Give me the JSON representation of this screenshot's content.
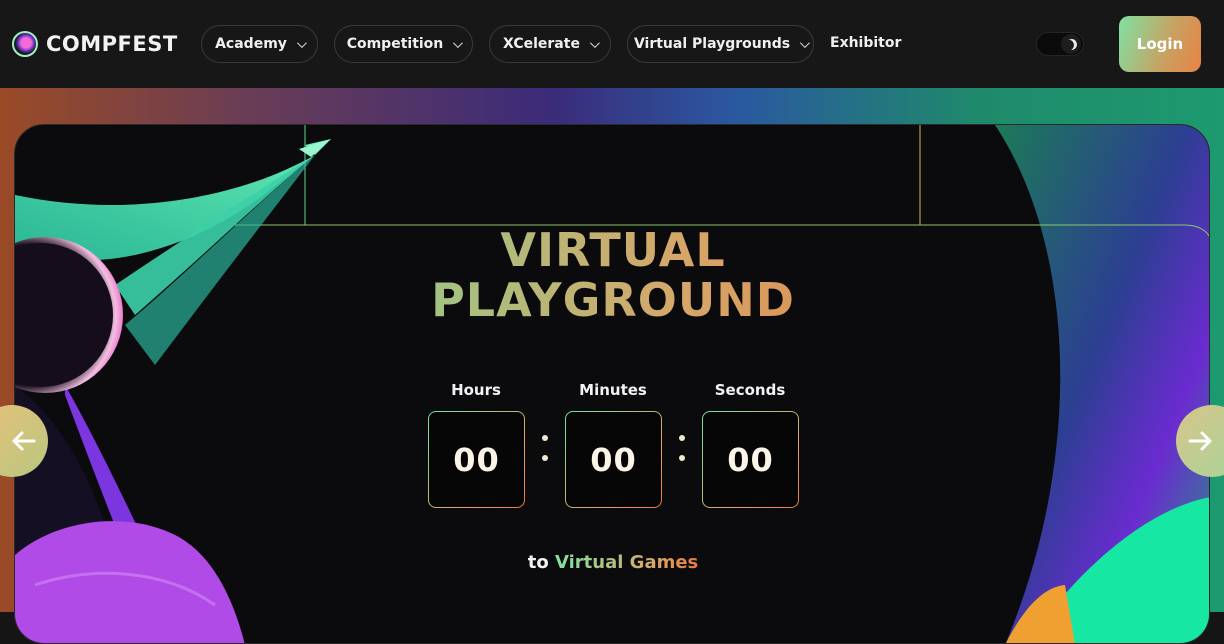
{
  "brand": {
    "name": "COMPFEST"
  },
  "nav": {
    "items": [
      {
        "label": "Academy"
      },
      {
        "label": "Competition"
      },
      {
        "label": "XCelerate"
      },
      {
        "label": "Virtual Playgrounds"
      }
    ],
    "link": "Exhibitor",
    "login_label": "Login",
    "theme_icon": "moon-icon"
  },
  "hero": {
    "title_line1": "VIRTUAL",
    "title_line2": "PLAYGROUND",
    "timer": {
      "hours_label": "Hours",
      "minutes_label": "Minutes",
      "seconds_label": "Seconds",
      "hours": "00",
      "minutes": "00",
      "seconds": "00"
    },
    "subtitle_prefix": "to",
    "subtitle_highlight": "Virtual Games",
    "prev_icon": "arrow-left-icon",
    "next_icon": "arrow-right-icon"
  },
  "colors": {
    "accent_green": "#66e3a1",
    "accent_orange": "#e8793e",
    "background": "#0b0a0d"
  }
}
